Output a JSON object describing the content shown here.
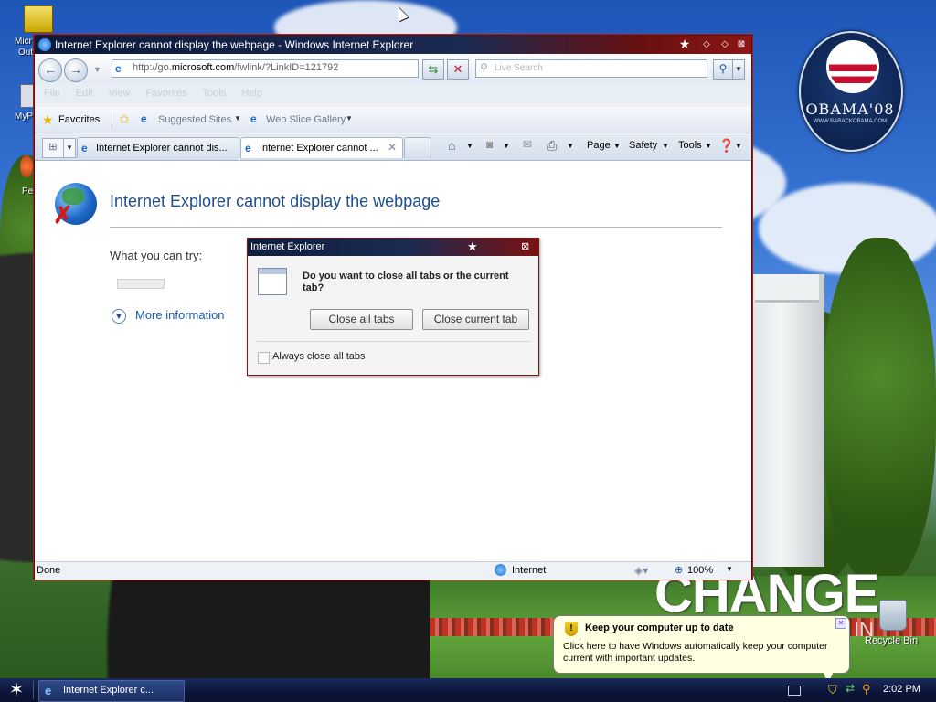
{
  "desktop": {
    "logo_text": "OBAMA'08",
    "logo_url": "WWW.BARACKOBAMA.COM",
    "change_text": "CHANGE",
    "change_suffix": "IN",
    "icons": [
      {
        "name": "Micr Out",
        "label1": "Micr",
        "label2": "Out"
      },
      {
        "name": "MyP",
        "label": "MyP"
      },
      {
        "name": "Pe",
        "label": "Pe"
      }
    ],
    "recycle_bin": "Recycle Bin"
  },
  "ie": {
    "title": "Internet Explorer cannot display the webpage - Windows Internet Explorer",
    "address_prefix": "http://go.",
    "address_domain": "microsoft.com",
    "address_suffix": "/fwlink/?LinkID=121792",
    "search_placeholder": "Live Search",
    "menu_faded": "File Edit View Favorites Tools Help",
    "favorites_label": "Favorites",
    "suggested_sites": "Suggested Sites",
    "web_slice_gallery": "Web Slice Gallery",
    "tabs": [
      {
        "label": "Internet Explorer cannot dis...",
        "active": false
      },
      {
        "label": "Internet Explorer cannot ...",
        "active": true
      }
    ],
    "commands": {
      "page": "Page",
      "safety": "Safety",
      "tools": "Tools"
    },
    "content": {
      "error_title": "Internet Explorer cannot display the webpage",
      "try_label": "What you can try:",
      "more_info": "More information"
    },
    "status": {
      "text": "Done",
      "zone": "Internet",
      "zoom": "100%"
    }
  },
  "dialog": {
    "title": "Internet Explorer",
    "question": "Do you want to close all tabs or the current tab?",
    "close_all": "Close all tabs",
    "close_current": "Close current tab",
    "always_close": "Always close all tabs"
  },
  "balloon": {
    "title": "Keep your computer up to date",
    "text": "Click here to have Windows automatically keep your computer current with important updates."
  },
  "taskbar": {
    "task_label": "Internet Explorer c...",
    "clock": "2:02 PM"
  }
}
